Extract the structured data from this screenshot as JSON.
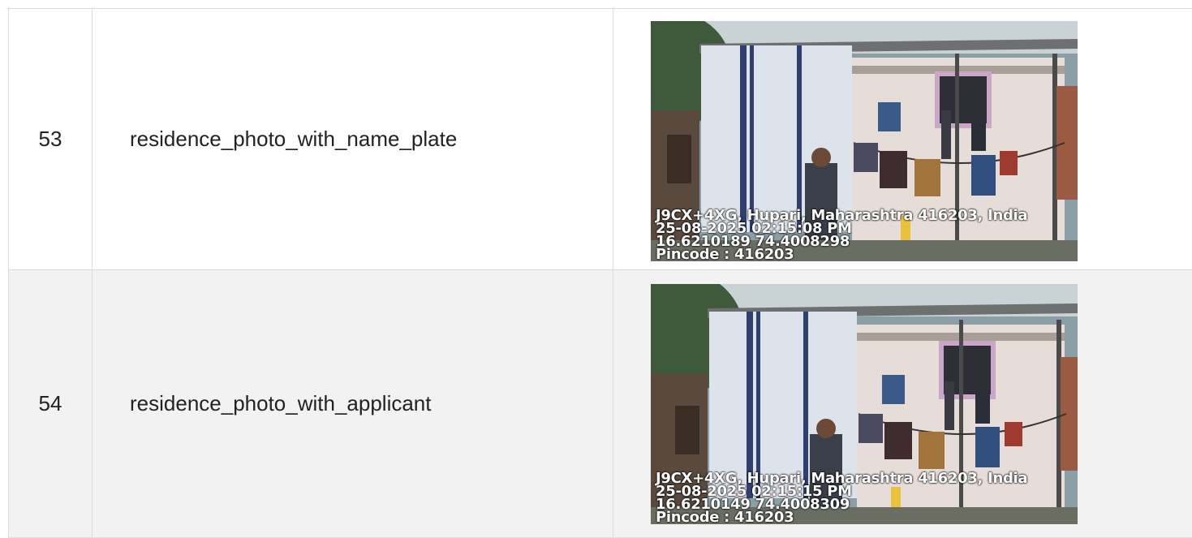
{
  "rows": [
    {
      "index": "53",
      "label": "residence_photo_with_name_plate",
      "photo": {
        "address": "J9CX+4XG, Hupari, Maharashtra 416203, India",
        "datetime": "25-08-2025 02:15:08 PM",
        "coords": "16.6210189 74.4008298",
        "pincode": "Pincode : 416203"
      }
    },
    {
      "index": "54",
      "label": "residence_photo_with_applicant",
      "photo": {
        "address": "J9CX+4XG, Hupari, Maharashtra 416203, India",
        "datetime": "25-08-2025 02:15:15 PM",
        "coords": "16.6210149 74.4008309",
        "pincode": "Pincode : 416203"
      }
    }
  ]
}
